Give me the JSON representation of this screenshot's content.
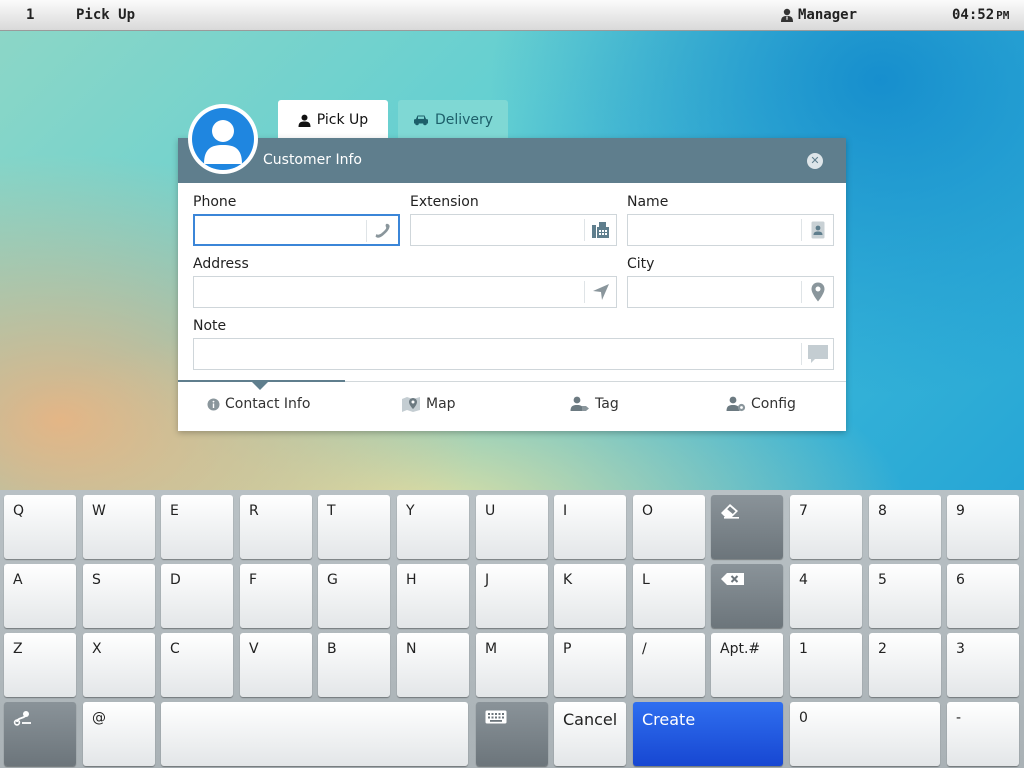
{
  "topbar": {
    "number": "1",
    "title": "Pick Up",
    "user": "Manager",
    "time": "04:52",
    "ampm": "PM"
  },
  "tabs": [
    {
      "label": "Pick Up",
      "icon": "person-icon",
      "active": true
    },
    {
      "label": "Delivery",
      "icon": "car-icon",
      "active": false
    }
  ],
  "panel": {
    "title": "Customer Info",
    "fields": {
      "phone": {
        "label": "Phone",
        "value": "",
        "icon": "phone-icon"
      },
      "extension": {
        "label": "Extension",
        "value": "",
        "icon": "fax-icon"
      },
      "name": {
        "label": "Name",
        "value": "",
        "icon": "contact-card-icon"
      },
      "address": {
        "label": "Address",
        "value": "",
        "icon": "navigation-arrow-icon"
      },
      "city": {
        "label": "City",
        "value": "",
        "icon": "map-pin-icon"
      },
      "note": {
        "label": "Note",
        "value": "",
        "icon": "speech-bubble-icon"
      }
    },
    "subtabs": [
      {
        "label": "Contact Info",
        "icon": "info-icon",
        "active": true
      },
      {
        "label": "Map",
        "icon": "map-icon",
        "active": false
      },
      {
        "label": "Tag",
        "icon": "user-tag-icon",
        "active": false
      },
      {
        "label": "Config",
        "icon": "user-gear-icon",
        "active": false
      }
    ]
  },
  "keyboard": {
    "row1": [
      "Q",
      "W",
      "E",
      "R",
      "T",
      "Y",
      "U",
      "I",
      "O"
    ],
    "row1_right": [
      "7",
      "8",
      "9"
    ],
    "row2": [
      "A",
      "S",
      "D",
      "F",
      "G",
      "H",
      "J",
      "K",
      "L"
    ],
    "row2_right": [
      "4",
      "5",
      "6"
    ],
    "row3": [
      "Z",
      "X",
      "C",
      "V",
      "B",
      "N",
      "M",
      "P",
      "/"
    ],
    "apt_label": "Apt.#",
    "row3_right": [
      "1",
      "2",
      "3"
    ],
    "at_label": "@",
    "cancel_label": "Cancel",
    "create_label": "Create",
    "zero_label": "0",
    "dash_label": "-"
  },
  "colors": {
    "header": "#5f7e8d",
    "create": "#1f5ee6",
    "avatar": "#1f86e0",
    "focus": "#3b86d8"
  }
}
